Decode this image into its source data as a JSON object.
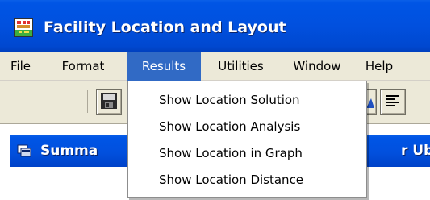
{
  "window": {
    "title": "Facility Location and Layout",
    "icon": "app-icon"
  },
  "menubar": {
    "items": [
      {
        "label": "File"
      },
      {
        "label": "Format"
      },
      {
        "label": "Results",
        "active": true
      },
      {
        "label": "Utilities"
      },
      {
        "label": "Window"
      },
      {
        "label": "Help"
      }
    ]
  },
  "toolbar": {
    "buttons": [
      {
        "icon": "save-icon"
      },
      {
        "icon": "chart-icon"
      },
      {
        "icon": "align-text-icon"
      }
    ]
  },
  "results_menu": {
    "items": [
      {
        "label": "Show Location Solution"
      },
      {
        "label": "Show Location Analysis"
      },
      {
        "label": "Show Location in Graph"
      },
      {
        "label": "Show Location Distance"
      }
    ]
  },
  "child_window": {
    "title_left": "Summa",
    "title_right": "r Ubi",
    "icon": "document-window-icon"
  },
  "colors": {
    "titlebar_blue": "#0054e3",
    "menu_highlight": "#316ac5",
    "chrome_beige": "#ece9d8"
  }
}
